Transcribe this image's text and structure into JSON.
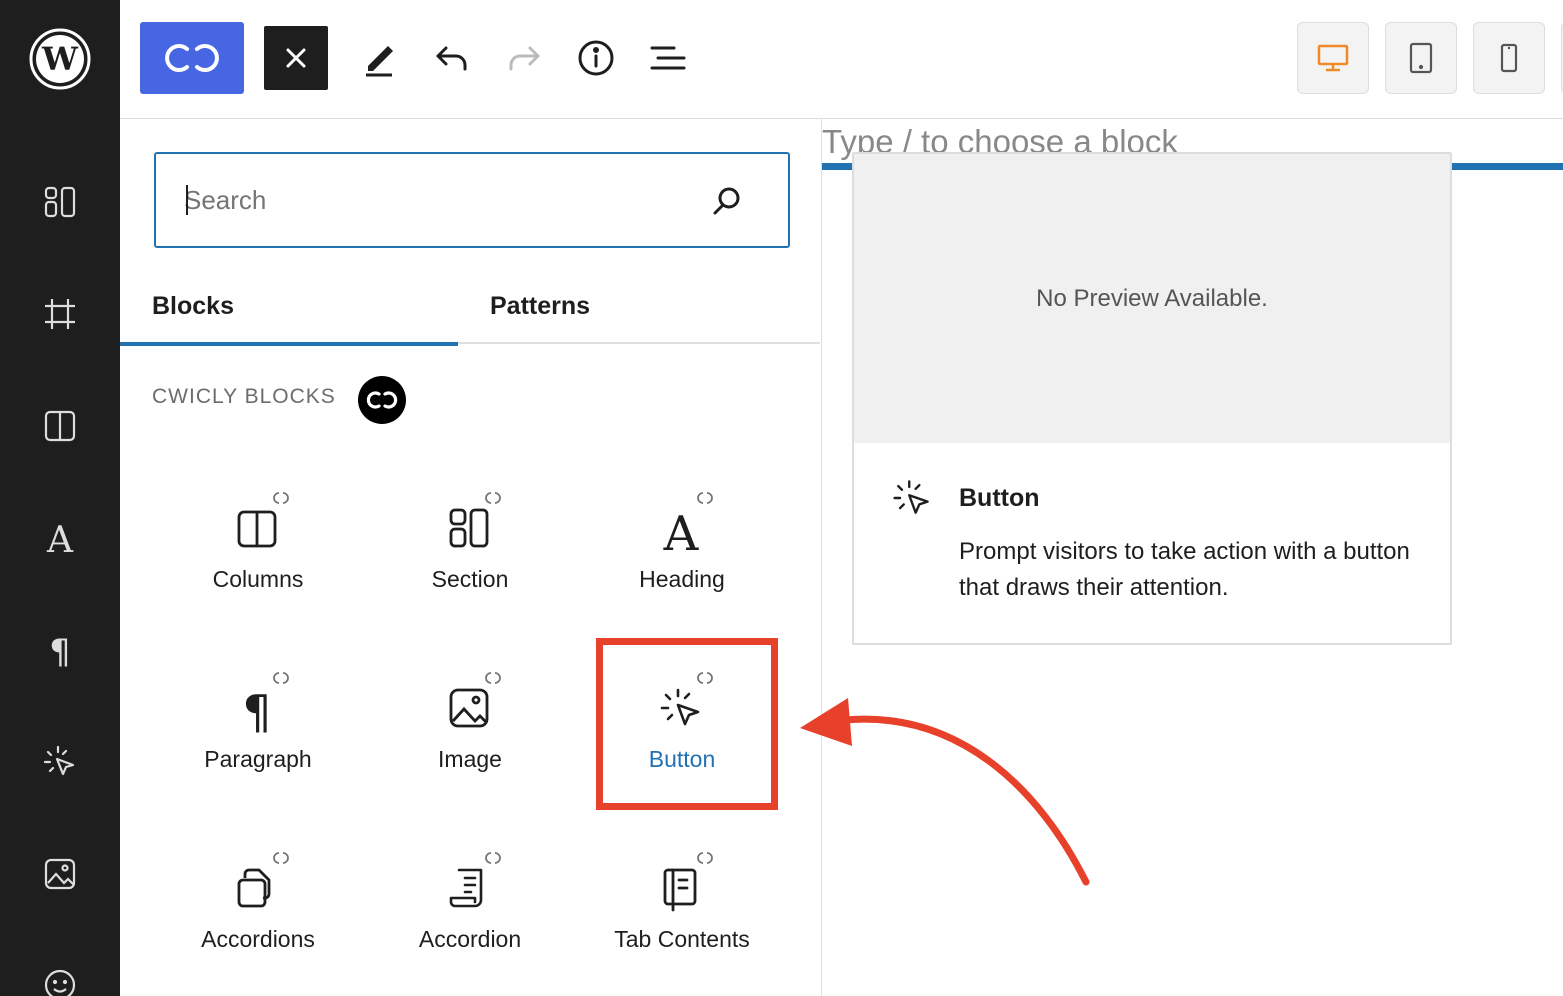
{
  "search": {
    "placeholder": "Search",
    "value": ""
  },
  "tabs": [
    {
      "label": "Blocks",
      "active": true
    },
    {
      "label": "Patterns",
      "active": false
    }
  ],
  "category": {
    "title": "CWICLY BLOCKS"
  },
  "blocks": [
    {
      "label": "Columns",
      "icon": "columns-icon"
    },
    {
      "label": "Section",
      "icon": "section-icon"
    },
    {
      "label": "Heading",
      "icon": "heading-icon"
    },
    {
      "label": "Paragraph",
      "icon": "paragraph-icon"
    },
    {
      "label": "Image",
      "icon": "image-icon"
    },
    {
      "label": "Button",
      "icon": "button-cursor-icon",
      "active": true
    },
    {
      "label": "Accordions",
      "icon": "accordions-icon"
    },
    {
      "label": "Accordion",
      "icon": "accordion-icon"
    },
    {
      "label": "Tab Contents",
      "icon": "tab-contents-icon"
    }
  ],
  "canvas": {
    "placeholder": "Type / to choose a block"
  },
  "preview": {
    "no_preview": "No Preview Available.",
    "title": "Button",
    "description": "Prompt visitors to take action with a button that draws their attention."
  },
  "colors": {
    "accent": "#2271b1",
    "cwicly_blue": "#4666e3",
    "highlight_red": "#e8412b",
    "sidebar_bg": "#1e1e1e",
    "desktop_active": "#f08a24"
  }
}
